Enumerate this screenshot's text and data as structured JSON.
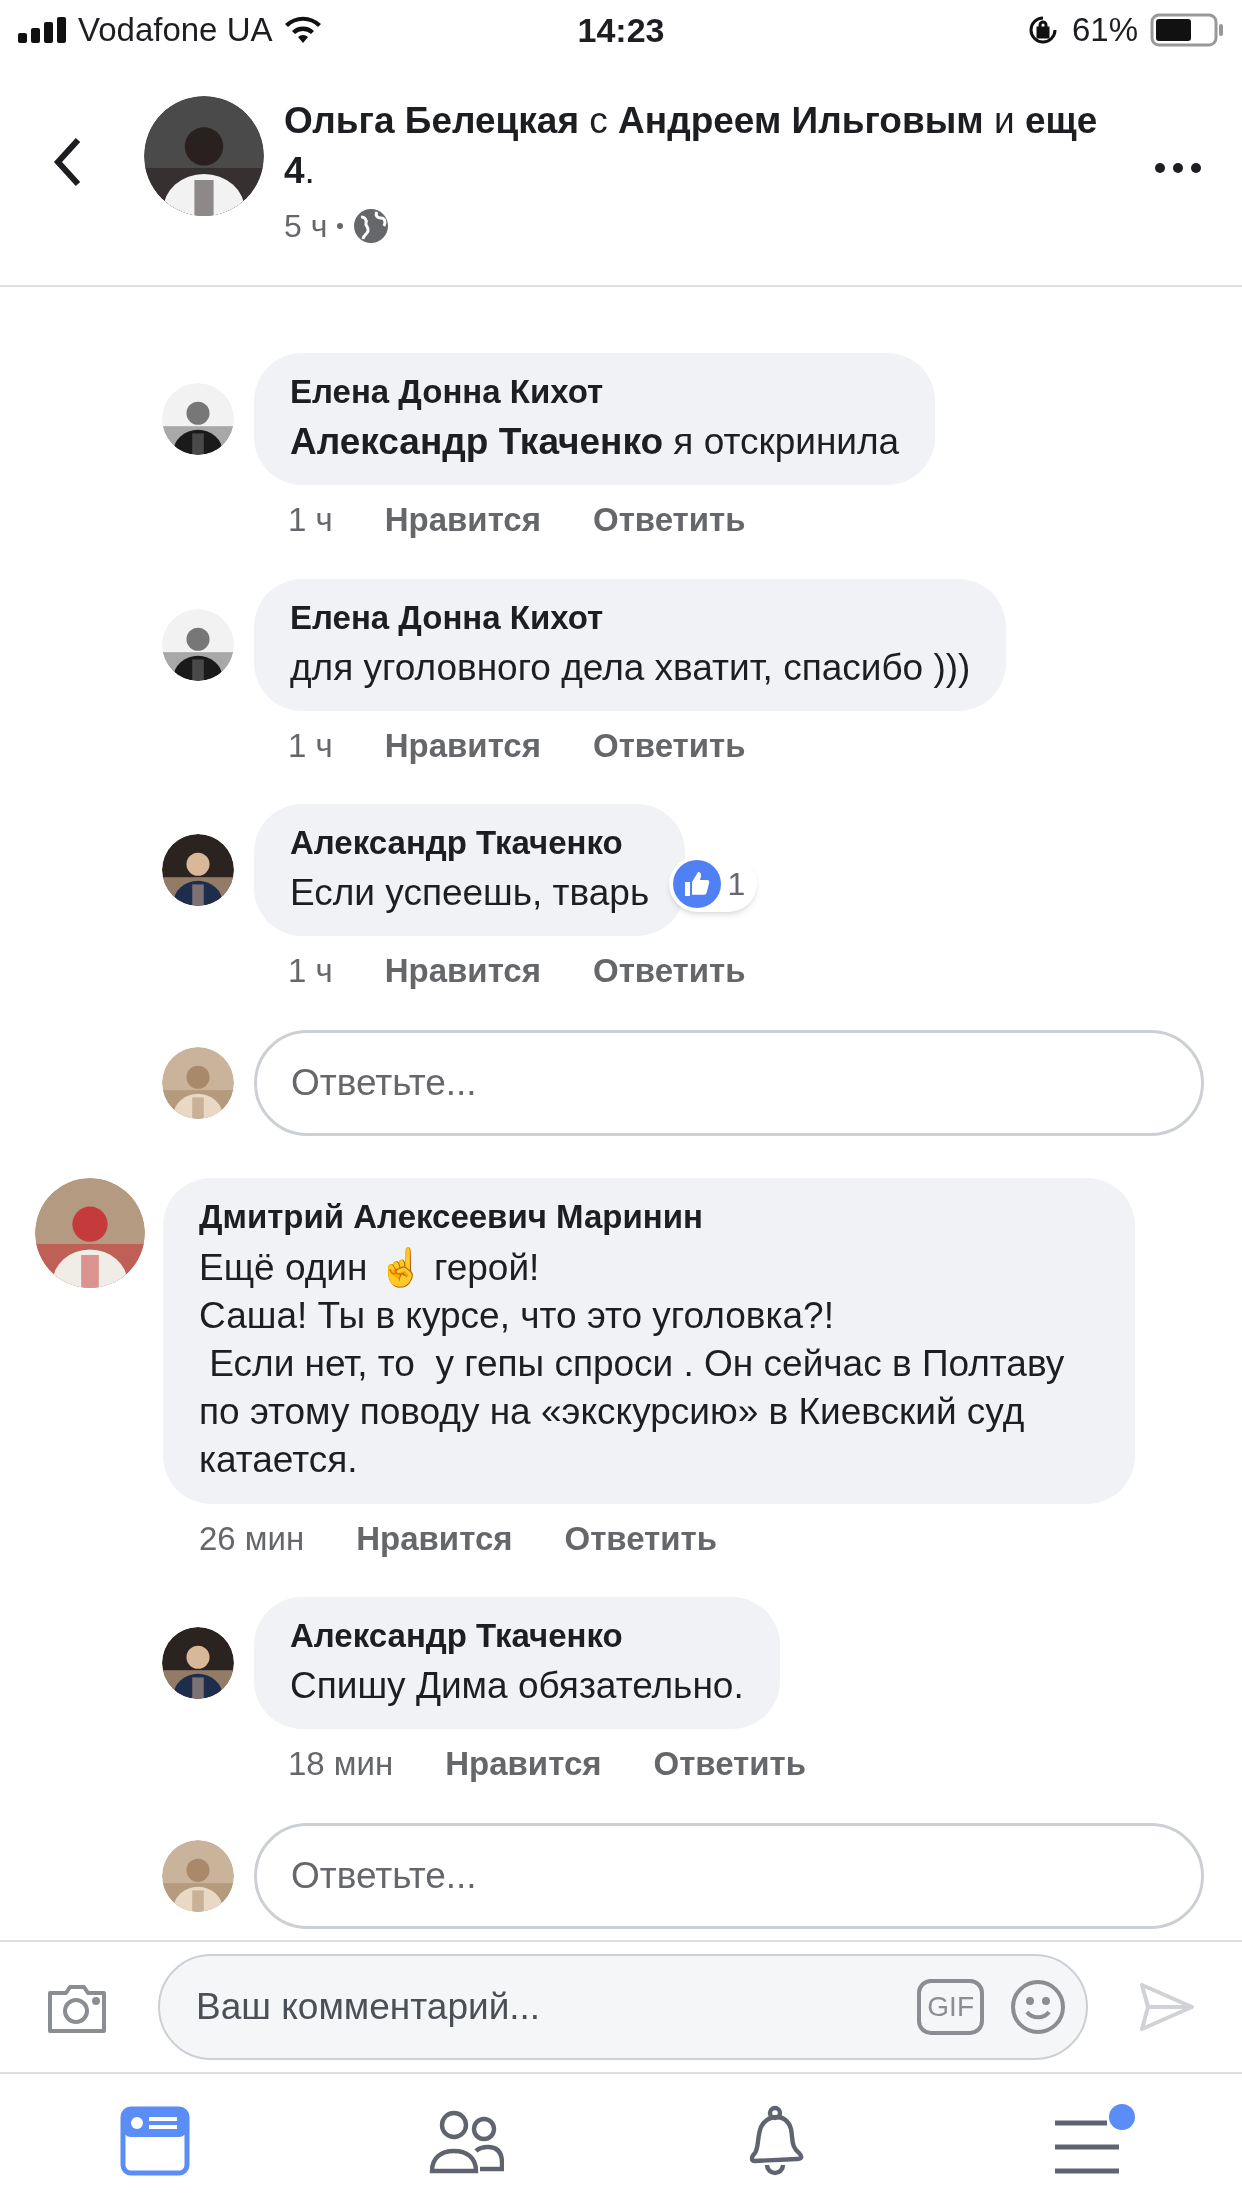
{
  "status_bar": {
    "carrier": "Vodafone UA",
    "time": "14:23",
    "battery": "61%"
  },
  "header": {
    "title": "**Ольга Белецкая** с **Андреем Ильговым** и **еще 4**.",
    "time": "5 ч"
  },
  "thread": [
    {
      "kind": "reply",
      "author": "Елена Донна Кихот",
      "text": "**Александр Ткаченко** я отскринила",
      "time": "1 ч",
      "like": "Нравится",
      "reply": "Ответить"
    },
    {
      "kind": "reply",
      "author": "Елена Донна Кихот",
      "text": "для уголовного дела хватит, спасибо )))",
      "time": "1 ч",
      "like": "Нравится",
      "reply": "Ответить"
    },
    {
      "kind": "reply",
      "author": "Александр Ткаченко",
      "text": "Если успеешь, тварь",
      "time": "1 ч",
      "like": "Нравится",
      "reply": "Ответить",
      "reactions": "1"
    },
    {
      "kind": "reply_field",
      "placeholder": "Ответьте..."
    },
    {
      "kind": "comment",
      "author": "Дмитрий Алексеевич Маринин",
      "lines": [
        "Ещё один ☝️ герой!",
        "Саша! Ты в курсе, что это уголовка?!",
        " Если нет, то  у гепы спроси . Он сейчас в Полтаву по этому поводу на «экскурсию» в Киевский суд катается."
      ],
      "time": "26 мин",
      "like": "Нравится",
      "reply": "Ответить"
    },
    {
      "kind": "reply",
      "author": "Александр Ткаченко",
      "text": "Спишу Дима обязательно.",
      "time": "18 мин",
      "like": "Нравится",
      "reply": "Ответить"
    },
    {
      "kind": "reply_field",
      "placeholder": "Ответьте..."
    }
  ],
  "composer": {
    "placeholder": "Ваш комментарий...",
    "gif": "GIF",
    "send_enabled": false
  },
  "tabs": [
    {
      "kind": "news",
      "selected": true,
      "dot": false
    },
    {
      "kind": "friends",
      "selected": false,
      "dot": false
    },
    {
      "kind": "notifications",
      "selected": false,
      "dot": false
    },
    {
      "kind": "menu",
      "selected": false,
      "dot": true
    }
  ]
}
